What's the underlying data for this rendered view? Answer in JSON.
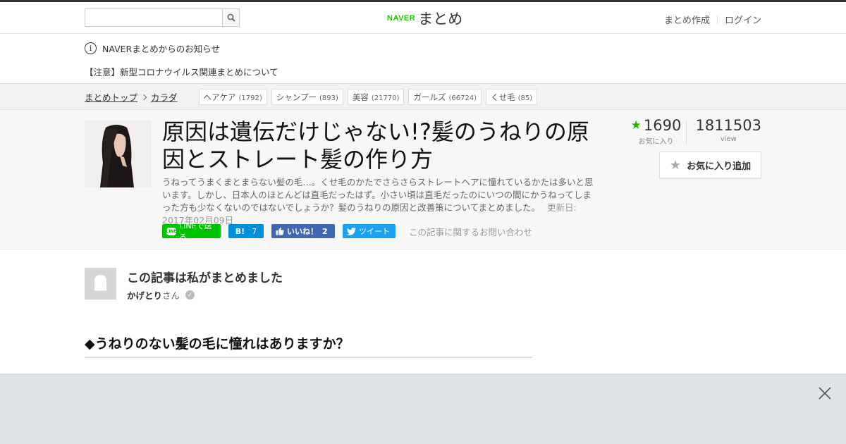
{
  "header": {
    "search_placeholder": "",
    "logo_naver": "NAVER",
    "logo_matome": "まとめ",
    "create_link": "まとめ作成",
    "login_link": "ログイン"
  },
  "notice": {
    "heading": "NAVERまとめからのお知らせ",
    "item": "【注意】新型コロナウイルス関連まとめについて"
  },
  "breadcrumb": {
    "top": "まとめトップ",
    "category": "カラダ",
    "tags": [
      {
        "label": "ヘアケア",
        "count": "(1792)"
      },
      {
        "label": "シャンプー",
        "count": "(893)"
      },
      {
        "label": "美容",
        "count": "(21770)"
      },
      {
        "label": "ガールズ",
        "count": "(66724)"
      },
      {
        "label": "くせ毛",
        "count": "(85)"
      }
    ]
  },
  "article": {
    "title": "原因は遺伝だけじゃない!?髪のうねりの原因とストレート髪の作り方",
    "description": "うねってうまくまとまらない髪の毛…。くせ毛のかたでさらさらストレートヘアに憧れているかたは多いと思います。しかし、日本人のほとんどは直毛だったはず。小さい頃は直毛だったのにいつの間にかうねってしまった方も少なくないのではないでしょうか？髪のうねりの原因と改善策についてまとめました。",
    "updated": "更新日: 2017年02月09日",
    "share": {
      "line": "LINEで送る",
      "line_logo": "LINE",
      "hatena": "B!",
      "hatena_count": "7",
      "fb": "いいね！",
      "fb_count": "2",
      "tw": "ツイート",
      "inquiry": "この記事に関するお問い合わせ"
    },
    "favorites_count": "1690",
    "favorites_label": "お気に入り",
    "view_count": "1811503",
    "view_label": "view",
    "fav_button": "お気に入り追加"
  },
  "author": {
    "heading": "この記事は私がまとめました",
    "name": "かげとり",
    "suffix": "さん"
  },
  "section": {
    "heading": "◆うねりのない髪の毛に憧れはありますか？"
  },
  "colors": {
    "naver_green": "#1ec800",
    "line_green": "#00c300",
    "hatena_blue": "#008fde",
    "fb_blue": "#4267b2",
    "twitter_blue": "#1da1f2",
    "star_green": "#2db400"
  },
  "icons": {
    "search": "search-icon",
    "info": "info-icon",
    "star": "star-icon",
    "close": "close-icon",
    "verified": "verified-icon"
  }
}
